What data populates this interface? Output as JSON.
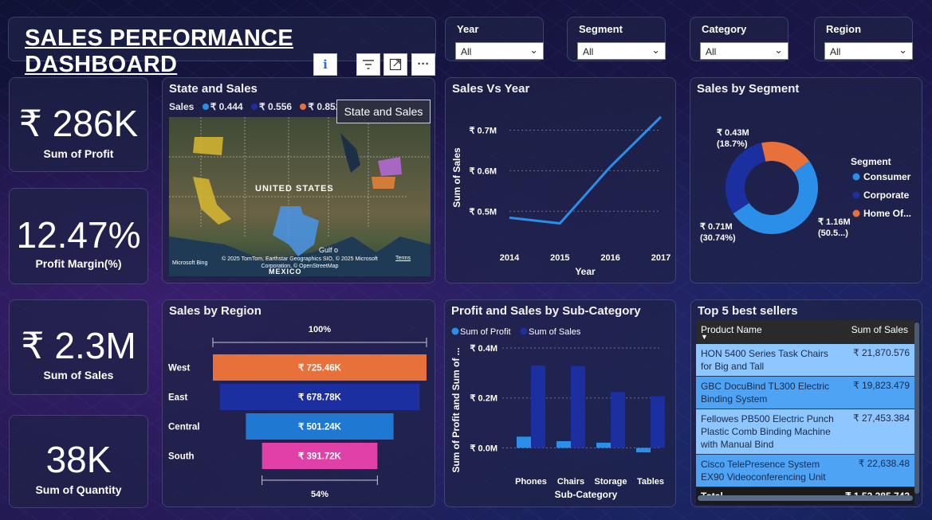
{
  "title": "SALES PERFORMANCE DASHBOARD",
  "filters": [
    {
      "label": "Year",
      "value": "All"
    },
    {
      "label": "Segment",
      "value": "All"
    },
    {
      "label": "Category",
      "value": "All"
    },
    {
      "label": "Region",
      "value": "All"
    }
  ],
  "visual_header": {
    "info_icon": "info-icon",
    "filter_icon": "filter-icon",
    "focus_icon": "focus-mode-icon",
    "more_icon": "more-options-icon"
  },
  "kpis": [
    {
      "value": "₹ 286K",
      "caption": "Sum of Profit"
    },
    {
      "value": "12.47%",
      "caption": "Profit Margin(%)"
    },
    {
      "value": "₹ 2.3M",
      "caption": "Sum of Sales"
    },
    {
      "value": "38K",
      "caption": "Sum of Quantity"
    }
  ],
  "map": {
    "title": "State and Sales",
    "legend_label": "Sales",
    "legend": [
      {
        "label": "₹ 0.444",
        "color": "#2b8ee8"
      },
      {
        "label": "₹ 0.556",
        "color": "#1c2fa0"
      },
      {
        "label": "₹ 0.852",
        "color": "#e8703a"
      },
      {
        "label": "",
        "color": "#9b2fc0"
      }
    ],
    "tooltip": "State and Sales",
    "country_label": "UNITED STATES",
    "mexico_label": "MEXICO",
    "gulf_label": "Gulf o",
    "bing": "Microsoft Bing",
    "attribution": "© 2025 TomTom, Earthstar Geographics SIO, © 2025 Microsoft Corporation, © OpenStreetMap",
    "terms": "Terms"
  },
  "sales_vs_year": {
    "title": "Sales Vs Year",
    "chart_data": {
      "type": "line",
      "x": [
        "2014",
        "2015",
        "2016",
        "2017"
      ],
      "series": [
        {
          "values": [
            0.484,
            0.47,
            0.61,
            0.733
          ]
        }
      ],
      "xlabel": "Year",
      "ylabel": "Sum of Sales",
      "ylim": [
        0.42,
        0.75
      ],
      "yticks": [
        "₹ 0.5M",
        "₹ 0.6M",
        "₹ 0.7M"
      ],
      "color": "#2b8ee8"
    }
  },
  "sales_by_segment": {
    "title": "Sales by Segment",
    "legend_title": "Segment",
    "chart_data": {
      "type": "pie",
      "categories": [
        "Consumer",
        "Corporate",
        "Home Of..."
      ],
      "values": [
        50.5,
        30.74,
        18.7
      ],
      "colors": [
        "#2b8ee8",
        "#1c2fa0",
        "#e8703a"
      ],
      "labels": [
        {
          "value": "₹ 1.16M",
          "pct": "(50.5...)"
        },
        {
          "value": "₹ 0.71M",
          "pct": "(30.74%)"
        },
        {
          "value": "₹ 0.43M",
          "pct": "(18.7%)"
        }
      ]
    }
  },
  "sales_by_region": {
    "title": "Sales by Region",
    "top_pct": "100%",
    "bottom_pct": "54%",
    "chart_data": {
      "type": "bar",
      "categories": [
        "West",
        "East",
        "Central",
        "South"
      ],
      "values": [
        725.46,
        678.78,
        501.24,
        391.72
      ],
      "labels": [
        "₹ 725.46K",
        "₹ 678.78K",
        "₹ 501.24K",
        "₹ 391.72K"
      ],
      "colors": [
        "#e8703a",
        "#1c2fa0",
        "#1f78d1",
        "#e040a8"
      ]
    }
  },
  "profit_sales_subcat": {
    "title": "Profit and Sales by Sub-Category",
    "chart_data": {
      "type": "bar",
      "categories": [
        "Phones",
        "Chairs",
        "Storage",
        "Tables"
      ],
      "series": [
        {
          "name": "Sum of Profit",
          "values": [
            0.045,
            0.027,
            0.021,
            -0.018
          ],
          "color": "#2b8ee8"
        },
        {
          "name": "Sum of Sales",
          "values": [
            0.33,
            0.328,
            0.224,
            0.207
          ],
          "color": "#1c2fa0"
        }
      ],
      "xlabel": "Sub-Category",
      "ylabel": "Sum of Profit and Sum of ...",
      "ylim": [
        -0.04,
        0.4
      ],
      "yticks": [
        "₹ 0.0M",
        "₹ 0.2M",
        "₹ 0.4M"
      ]
    }
  },
  "top5": {
    "title": "Top 5 best sellers",
    "headers": [
      "Product Name",
      "Sum of Sales"
    ],
    "rows": [
      {
        "name": "HON 5400 Series Task Chairs for Big and Tall",
        "sales": "₹ 21,870.576"
      },
      {
        "name": "GBC DocuBind TL300 Electric Binding System",
        "sales": "₹ 19,823.479"
      },
      {
        "name": "Fellowes PB500 Electric Punch Plastic Comb Binding Machine with Manual Bind",
        "sales": "₹ 27,453.384"
      },
      {
        "name": "Cisco TelePresence System EX90 Videoconferencing Unit",
        "sales": "₹ 22,638.48"
      }
    ],
    "total_label": "Total",
    "total_value": "₹ 1,53,385.743"
  }
}
